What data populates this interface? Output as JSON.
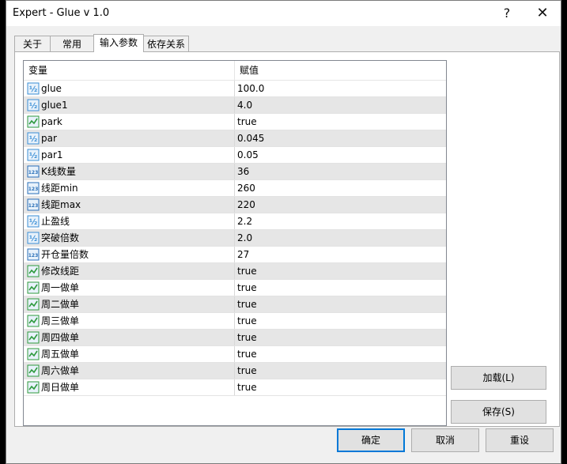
{
  "window": {
    "title": "Expert - Glue v 1.0",
    "help_glyph": "?",
    "close_glyph": "✕"
  },
  "tabs": [
    {
      "label": "关于",
      "active": false
    },
    {
      "label": "常用",
      "active": false
    },
    {
      "label": "输入参数",
      "active": true
    },
    {
      "label": "依存关系",
      "active": false
    }
  ],
  "grid": {
    "headers": {
      "variable": "变量",
      "value": "赋值"
    },
    "rows": [
      {
        "icon": "double",
        "name": "glue",
        "value": "100.0"
      },
      {
        "icon": "double",
        "name": "glue1",
        "value": "4.0"
      },
      {
        "icon": "bool",
        "name": "park",
        "value": "true"
      },
      {
        "icon": "double",
        "name": "par",
        "value": "0.045"
      },
      {
        "icon": "double",
        "name": "par1",
        "value": "0.05"
      },
      {
        "icon": "int",
        "name": "K线数量",
        "value": "36"
      },
      {
        "icon": "int",
        "name": "线距min",
        "value": "260"
      },
      {
        "icon": "int",
        "name": "线距max",
        "value": "220"
      },
      {
        "icon": "double",
        "name": "止盈线",
        "value": "2.2"
      },
      {
        "icon": "double",
        "name": "突破倍数",
        "value": "2.0"
      },
      {
        "icon": "int",
        "name": "开仓量倍数",
        "value": "27"
      },
      {
        "icon": "bool",
        "name": "修改线距",
        "value": "true"
      },
      {
        "icon": "bool",
        "name": "周一做单",
        "value": "true"
      },
      {
        "icon": "bool",
        "name": "周二做单",
        "value": "true"
      },
      {
        "icon": "bool",
        "name": "周三做单",
        "value": "true"
      },
      {
        "icon": "bool",
        "name": "周四做单",
        "value": "true"
      },
      {
        "icon": "bool",
        "name": "周五做单",
        "value": "true"
      },
      {
        "icon": "bool",
        "name": "周六做单",
        "value": "true"
      },
      {
        "icon": "bool",
        "name": "周日做单",
        "value": "true"
      }
    ]
  },
  "side_buttons": {
    "load": "加载(L)",
    "save": "保存(S)"
  },
  "footer_buttons": {
    "ok": "确定",
    "cancel": "取消",
    "reset": "重设"
  },
  "icon_text": {
    "double": "½",
    "int": "123"
  },
  "colors": {
    "accent": "#0078d7",
    "double_icon": "#3b8fd6",
    "int_icon": "#2a6fb8",
    "bool_icon": "#2e9a3e"
  }
}
